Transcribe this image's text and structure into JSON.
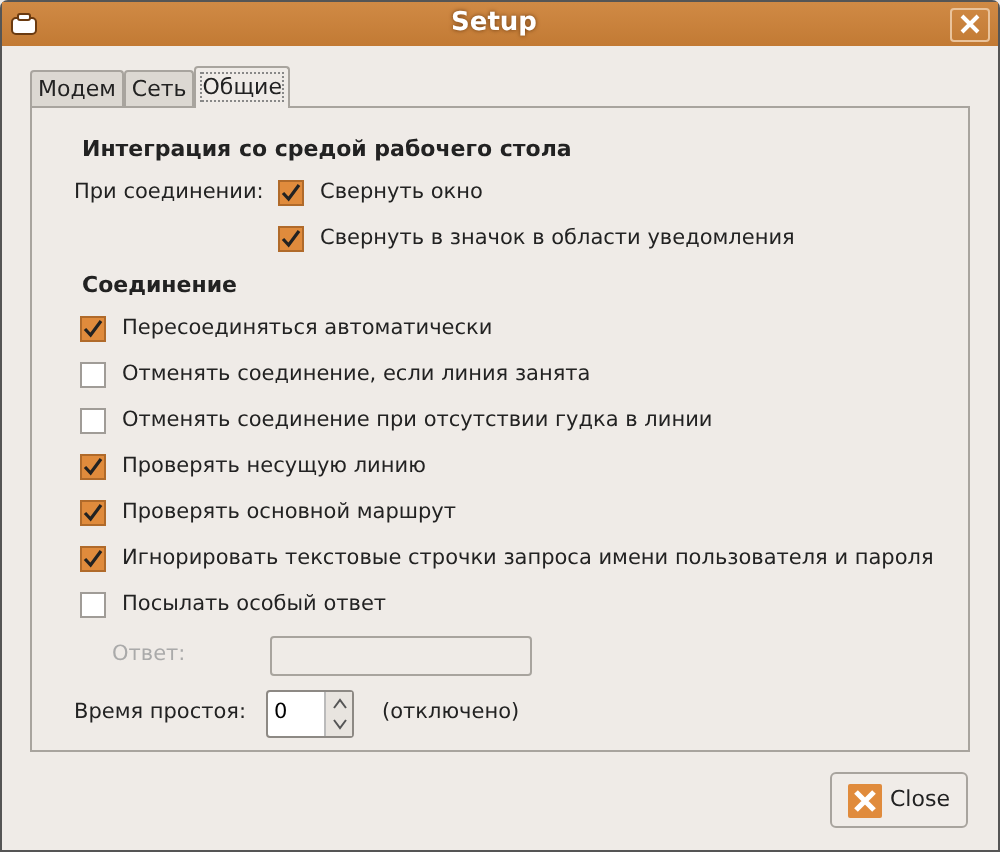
{
  "window": {
    "title": "Setup"
  },
  "tabs": [
    {
      "label": "Модем",
      "selected": false
    },
    {
      "label": "Сеть",
      "selected": false
    },
    {
      "label": "Общие",
      "selected": true
    }
  ],
  "desktop_section": {
    "heading": "Интеграция со средой рабочего стола",
    "label": "При соединении:",
    "options": [
      {
        "label": "Свернуть окно",
        "checked": true
      },
      {
        "label": "Свернуть в значок в области уведомления",
        "checked": true
      }
    ]
  },
  "connection_section": {
    "heading": "Соединение",
    "options": [
      {
        "label": "Пересоединяться автоматически",
        "checked": true
      },
      {
        "label": "Отменять соединение, если линия занята",
        "checked": false
      },
      {
        "label": "Отменять соединение при отсутствии гудка в линии",
        "checked": false
      },
      {
        "label": "Проверять несущую линию",
        "checked": true
      },
      {
        "label": "Проверять основной маршрут",
        "checked": true
      },
      {
        "label": "Игнорировать текстовые строчки запроса имени пользователя и пароля",
        "checked": true
      },
      {
        "label": "Посылать особый ответ",
        "checked": false
      }
    ],
    "answer": {
      "label": "Ответ:",
      "disabled": true
    },
    "idle": {
      "label": "Время простоя:",
      "value": "0",
      "note": "(отключено)"
    }
  },
  "buttons": [
    {
      "label": "Close"
    }
  ]
}
